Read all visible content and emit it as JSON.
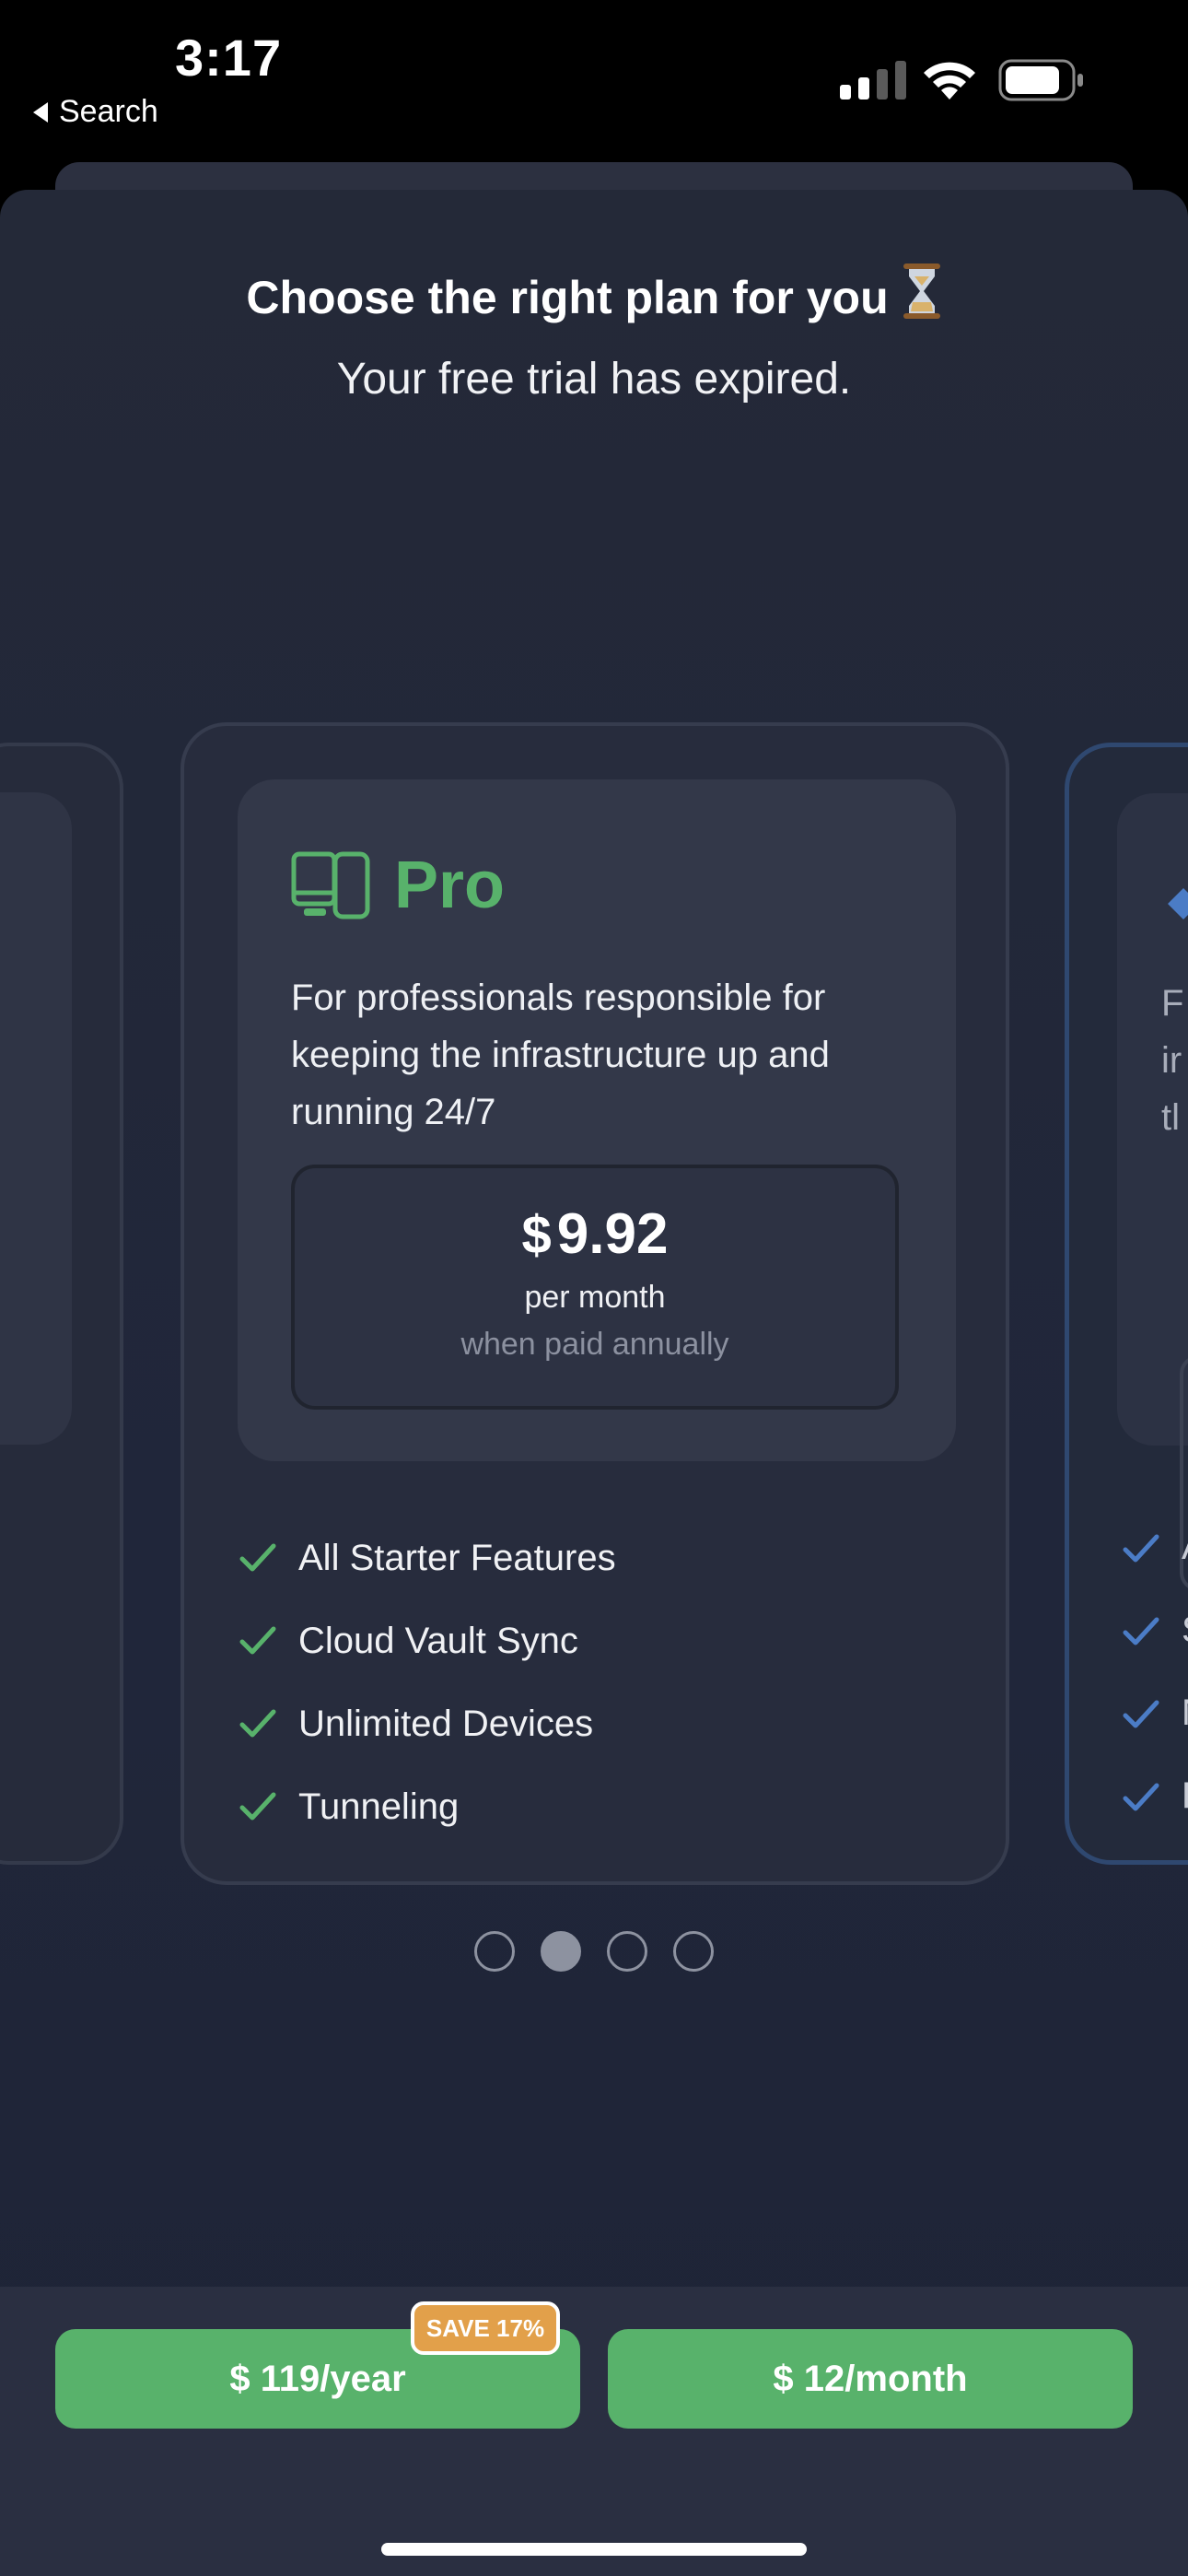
{
  "status_bar": {
    "time": "3:17",
    "back_label": "Search",
    "icons": [
      "cellular-signal-icon",
      "wifi-icon",
      "battery-icon"
    ]
  },
  "header": {
    "title": "Choose the right plan for you",
    "title_emoji": "hourglass-icon",
    "subtitle": "Your free trial has expired."
  },
  "plan": {
    "name": "Pro",
    "icon": "devices-icon",
    "description": "For professionals responsible for keeping the infrastructure up and running 24/7",
    "currency": "$",
    "price": "9.92",
    "per": "per month",
    "billing_note": "when paid annually",
    "features": [
      "All Starter Features",
      "Cloud Vault Sync",
      "Unlimited Devices",
      "Tunneling"
    ]
  },
  "next_plan_peek": {
    "description_letters": [
      "F",
      "ir",
      "tl"
    ],
    "feature_letters": [
      "A",
      "S",
      "N",
      "F"
    ]
  },
  "pager": {
    "count": 4,
    "active_index": 1
  },
  "purchase": {
    "yearly_label": "$ 119/year",
    "monthly_label": "$ 12/month",
    "save_badge": "SAVE 17%"
  },
  "colors": {
    "accent_green": "#58b26b",
    "badge_orange": "#e2a04a",
    "background": "#242938"
  }
}
